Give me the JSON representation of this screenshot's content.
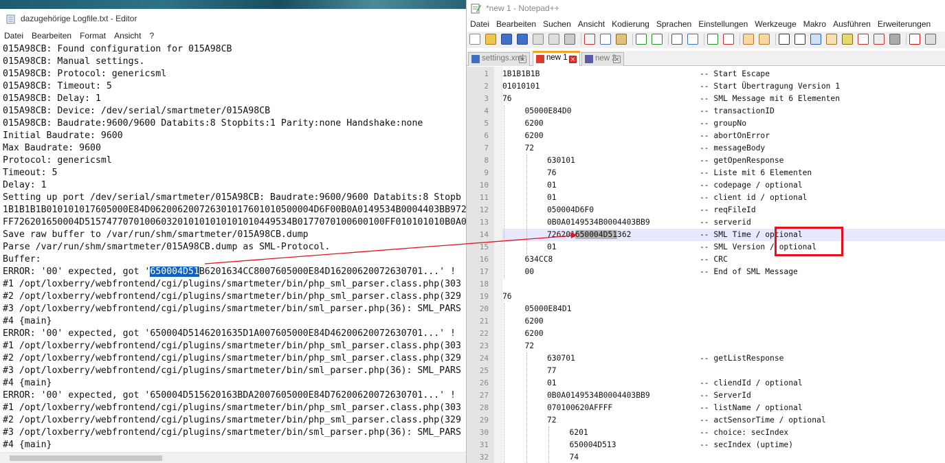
{
  "notepad": {
    "title": "dazugehörige Logfile.txt - Editor",
    "menu": [
      "Datei",
      "Bearbeiten",
      "Format",
      "Ansicht",
      "?"
    ],
    "lines": [
      "015A98CB: Found configuration for 015A98CB",
      "015A98CB: Manual settings.",
      "015A98CB: Protocol: genericsml",
      "015A98CB: Timeout: 5",
      "015A98CB: Delay: 1",
      "015A98CB: Device: /dev/serial/smartmeter/015A98CB",
      "015A98CB: Baudrate:9600/9600 Databits:8 Stopbits:1 Parity:none Handshake:none",
      "Initial Baudrate: 9600",
      "Max Baudrate: 9600",
      "Protocol: genericsml",
      "Timeout: 5",
      "Delay: 1",
      "Setting up port /dev/serial/smartmeter/015A98CB: Baudrate:9600/9600 Databits:8 Stopb",
      "1B1B1B1B010101017605000E84D062006200726301017601010500004D6F00B0A0149534B0004403BB972",
      "FF726201650004D51574770701006032010101010101010449534B0177070100600100FF010101010B0A01",
      "Save raw buffer to /var/run/shm/smartmeter/015A98CB.dump",
      "Parse /var/run/shm/smartmeter/015A98CB.dump as SML-Protocol.",
      "Buffer:",
      "ERROR: '00' expected, got '650004D51B6201634CC8007605000E84D16200620072630701...' !",
      "#1 /opt/loxberry/webfrontend/cgi/plugins/smartmeter/bin/php_sml_parser.class.php(303",
      "#2 /opt/loxberry/webfrontend/cgi/plugins/smartmeter/bin/php_sml_parser.class.php(329",
      "#3 /opt/loxberry/webfrontend/cgi/plugins/smartmeter/bin/sml_parser.php(36): SML_PARS",
      "#4 {main}",
      "ERROR: '00' expected, got '650004D5146201635D1A007605000E84D46200620072630701...' !",
      "#1 /opt/loxberry/webfrontend/cgi/plugins/smartmeter/bin/php_sml_parser.class.php(303",
      "#2 /opt/loxberry/webfrontend/cgi/plugins/smartmeter/bin/php_sml_parser.class.php(329",
      "#3 /opt/loxberry/webfrontend/cgi/plugins/smartmeter/bin/sml_parser.php(36): SML_PARS",
      "#4 {main}",
      "ERROR: '00' expected, got '650004D515620163BDA2007605000E84D76200620072630701...' !",
      "#1 /opt/loxberry/webfrontend/cgi/plugins/smartmeter/bin/php_sml_parser.class.php(303",
      "#2 /opt/loxberry/webfrontend/cgi/plugins/smartmeter/bin/php_sml_parser.class.php(329",
      "#3 /opt/loxberry/webfrontend/cgi/plugins/smartmeter/bin/sml_parser.php(36): SML_PARS",
      "#4 {main}"
    ],
    "selection": {
      "line": 18,
      "before": "ERROR: '00' expected, got '",
      "selected": "650004D51",
      "after": "B6201634CC8007605000E84D16200620072630701...' !"
    }
  },
  "npp": {
    "title": "*new 1 - Notepad++",
    "menu": [
      "Datei",
      "Bearbeiten",
      "Suchen",
      "Ansicht",
      "Kodierung",
      "Sprachen",
      "Einstellungen",
      "Werkzeuge",
      "Makro",
      "Ausführen",
      "Erweiterungen"
    ],
    "tabs": [
      {
        "label": "settings.xml",
        "active": false,
        "icon_color": "#3a6fc2"
      },
      {
        "label": "new 1",
        "active": true,
        "icon_color": "#d93a2c"
      },
      {
        "label": "new 2",
        "active": false,
        "icon_color": "#5a5aa8"
      }
    ],
    "current_line": 14,
    "lines": [
      {
        "n": "1",
        "indent": 0,
        "code": "1B1B1B1B",
        "comment": "-- Start Escape"
      },
      {
        "n": "2",
        "indent": 0,
        "code": "01010101",
        "comment": "-- Start Übertragung Version 1"
      },
      {
        "n": "3",
        "indent": 0,
        "code": "76",
        "comment": "-- SML Message mit 6 Elementen"
      },
      {
        "n": "4",
        "indent": 1,
        "code": "05000E84D0",
        "comment": "-- transactionID"
      },
      {
        "n": "5",
        "indent": 1,
        "code": "6200",
        "comment": "-- groupNo"
      },
      {
        "n": "6",
        "indent": 1,
        "code": "6200",
        "comment": "-- abortOnError"
      },
      {
        "n": "7",
        "indent": 1,
        "code": "72",
        "comment": "-- messageBody"
      },
      {
        "n": "8",
        "indent": 2,
        "code": "630101",
        "comment": "-- getOpenResponse"
      },
      {
        "n": "9",
        "indent": 2,
        "code": "76",
        "comment": "-- Liste mit 6 Elementen"
      },
      {
        "n": "10",
        "indent": 2,
        "code": "01",
        "comment": "-- codepage / optional"
      },
      {
        "n": "11",
        "indent": 2,
        "code": "01",
        "comment": "-- client id / optional"
      },
      {
        "n": "12",
        "indent": 2,
        "code": "050004D6F0",
        "comment": "-- reqFileId"
      },
      {
        "n": "13",
        "indent": 2,
        "code": "0B0A0149534B0004403BB9",
        "comment": "-- serverid"
      },
      {
        "n": "14",
        "indent": 2,
        "code": "726201650004D51362",
        "comment": "-- SML Time / optional",
        "hl_start": 6,
        "hl_end": 15
      },
      {
        "n": "15",
        "indent": 2,
        "code": "01",
        "comment": "-- SML Version / optional"
      },
      {
        "n": "16",
        "indent": 1,
        "code": "634CC8",
        "comment": "-- CRC"
      },
      {
        "n": "17",
        "indent": 1,
        "code": "00",
        "comment": "-- End of SML Message"
      },
      {
        "n": "18",
        "indent": 0,
        "code": "",
        "comment": ""
      },
      {
        "n": "19",
        "indent": 0,
        "code": "76",
        "comment": ""
      },
      {
        "n": "20",
        "indent": 1,
        "code": "05000E84D1",
        "comment": ""
      },
      {
        "n": "21",
        "indent": 1,
        "code": "6200",
        "comment": ""
      },
      {
        "n": "22",
        "indent": 1,
        "code": "6200",
        "comment": ""
      },
      {
        "n": "23",
        "indent": 1,
        "code": "72",
        "comment": ""
      },
      {
        "n": "24",
        "indent": 2,
        "code": "630701",
        "comment": "-- getListResponse"
      },
      {
        "n": "25",
        "indent": 2,
        "code": "77",
        "comment": ""
      },
      {
        "n": "26",
        "indent": 2,
        "code": "01",
        "comment": "-- cliendId / optional"
      },
      {
        "n": "27",
        "indent": 2,
        "code": "0B0A0149534B0004403BB9",
        "comment": "-- ServerId"
      },
      {
        "n": "28",
        "indent": 2,
        "code": "070100620AFFFF",
        "comment": "-- listName / optional"
      },
      {
        "n": "29",
        "indent": 2,
        "code": "72",
        "comment": "-- actSensorTime / optional"
      },
      {
        "n": "30",
        "indent": 3,
        "code": "6201",
        "comment": "-- choice: secIndex"
      },
      {
        "n": "31",
        "indent": 3,
        "code": "650004D513",
        "comment": "-- secIndex (uptime)"
      },
      {
        "n": "32",
        "indent": 3,
        "code": "74",
        "comment": ""
      }
    ]
  },
  "annotation": {
    "box_color": "#e6101c",
    "arrow_color": "#e6101c"
  }
}
